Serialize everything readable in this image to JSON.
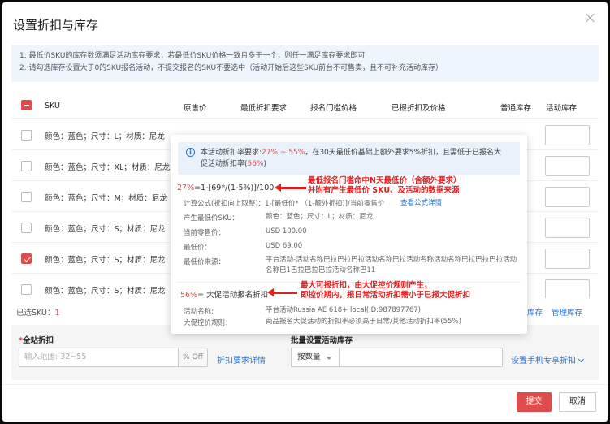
{
  "dialog": {
    "title": "设置折扣与库存",
    "notice": [
      "1. 最低价SKU的库存数须满足活动库存要求，若最低价SKU价格一致且多于一个，则任一满足库存要求即可",
      "2. 请勾选库存设置大于0的SKU报名活动，不提交报名的SKU不要选中（活动开始后这些SKU前台不可售卖，且不可补充活动库存）"
    ]
  },
  "table": {
    "headers": {
      "sku": "SKU",
      "orig_price": "原售价",
      "min_disc": "最低折扣要求",
      "threshold": "报名门槛价格",
      "reported": "已报折扣及价格",
      "normal_stock": "普通库存",
      "act_stock": "活动库存"
    },
    "rows": [
      {
        "sku": "颜色：蓝色；尺寸：L；材质：尼龙",
        "checked": false
      },
      {
        "sku": "颜色：蓝色；尺寸：XL；材质：尼龙",
        "checked": false
      },
      {
        "sku": "颜色：蓝色；尺寸：M；材质：尼龙",
        "checked": false
      },
      {
        "sku": "颜色：蓝色；尺寸：S；材质：尼龙",
        "checked": false
      },
      {
        "sku": "颜色：蓝色；尺寸：S；材质：尼龙",
        "checked": true
      },
      {
        "sku": "颜色：蓝色；尺寸：S；材质：尼龙",
        "checked": false
      }
    ]
  },
  "selected": {
    "label": "已选SKU：",
    "count": "1"
  },
  "stock_links": {
    "left": "库存",
    "right": "管理库存"
  },
  "bottom": {
    "discount_label": "全站折扣",
    "required_star": "*",
    "discount_placeholder": "输入范围: 32~55",
    "discount_suffix": "% Off",
    "requirement_link": "折扣要求详情",
    "batch_label": "批量设置活动库存",
    "qty_option": "按数量",
    "mobile_link": "设置手机专享折扣"
  },
  "footer": {
    "submit": "提交",
    "cancel": "取消"
  },
  "popover": {
    "info_prefix": "本活动折扣率要求:",
    "info_range": "27% ~ 55%",
    "info_middle": "，在30天最低价基础上额外要求5%折扣，且需低于已报名大",
    "info_line2_prefix": "促活动折扣率(",
    "info_pct": "56%",
    "info_line2_suffix": ")",
    "formula_pct": "27%",
    "formula_rest": "=1-[69*/(1-5%)]/100",
    "annot1_line1": "最低报名门槛命中N天最低价（含额外要求）",
    "annot1_line2": "并附有产生最低价 SKU、及活动的数据来源",
    "calc_label": "计算公式(折扣向上取整)：",
    "calc_value": "1-[最低价* （1-额外折扣)]/当前零售价",
    "formula_link": "查看公式详情",
    "kv": [
      {
        "k": "产生最低价SKU：",
        "v": "颜色：蓝色；尺寸：L；材质：尼龙"
      },
      {
        "k": "当前零售价：",
        "v": "USD 100.00"
      },
      {
        "k": "最低价：",
        "v": "USD 69.00"
      },
      {
        "k": "最低价来源：",
        "v": "平台活动-活动名称巴拉巴拉巴拉活动名称巴拉活动名称活动名称巴拉巴拉巴拉活动名称巴1巴拉巴拉巴拉活动名称巴11"
      }
    ],
    "bigpromo_pct": "56%",
    "bigpromo_text": "= 大促活动报名折扣",
    "annot2_line1": "最大可报折扣，由大促控价规则产生，",
    "annot2_line2": "即控价期内，报日常活动折扣需小于已报大促折扣",
    "act_name_k": "活动名称:",
    "act_name_v": "平台活动Russia AE 618+ local(ID:987897767)",
    "rule_k": "大促控价规则：",
    "rule_v": "商品报名大促活动的折扣率必须高于日常/其他活动折扣率(55%)"
  }
}
